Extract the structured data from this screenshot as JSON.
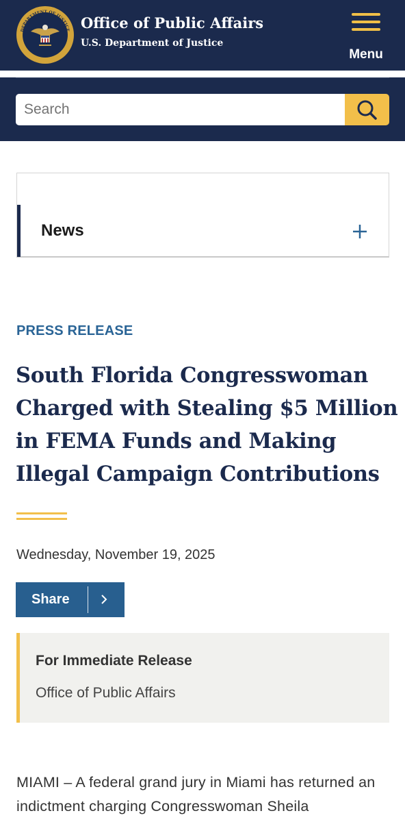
{
  "header": {
    "title": "Office of Public Affairs",
    "subtitle": "U.S. Department of Justice",
    "seal_text": "DEPARTMENT OF JUSTICE",
    "menu_label": "Menu",
    "menu_icon": "hamburger-icon"
  },
  "search": {
    "placeholder": "Search",
    "value": "",
    "button_icon": "search-icon"
  },
  "news_nav": {
    "label": "News",
    "toggle_icon": "plus-icon"
  },
  "article": {
    "category": "PRESS RELEASE",
    "headline": "South Florida Congresswoman Charged with Stealing $5 Million in FEMA Funds and Making Illegal Campaign Contributions",
    "date": "Wednesday, November 19, 2025",
    "share_label": "Share",
    "share_icon": "chevron-right-icon",
    "release_title": "For Immediate Release",
    "release_office": "Office of Public Affairs",
    "body": "MIAMI – A federal grand jury in Miami has returned an indictment charging Congresswoman Sheila"
  },
  "colors": {
    "navy": "#1b2a4d",
    "gold": "#f2bf4a",
    "link_blue": "#2a6496",
    "share_blue": "#285f8f",
    "release_bg": "#f1f1ee"
  }
}
